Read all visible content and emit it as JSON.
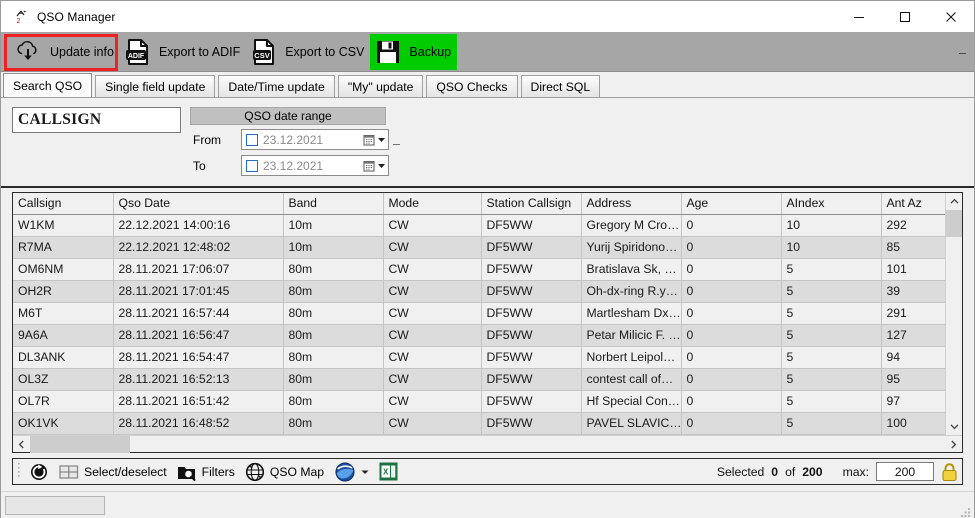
{
  "window": {
    "title": "QSO Manager",
    "icon": "antenna-icon",
    "controls": {
      "minimize": "minimize-icon",
      "maximize": "maximize-icon",
      "close": "close-icon"
    }
  },
  "toolbar": {
    "items": [
      {
        "label": "Update info",
        "icon": "cloud-download-icon",
        "focused": true,
        "highlight": "none"
      },
      {
        "label": "Export to ADIF",
        "icon": "adif-file-icon",
        "focused": false,
        "highlight": "none"
      },
      {
        "label": "Export to CSV",
        "icon": "csv-file-icon",
        "focused": false,
        "highlight": "none"
      },
      {
        "label": "Backup",
        "icon": "floppy-disk-icon",
        "focused": false,
        "highlight": "#00cc00"
      }
    ],
    "focus_ring_color": "#ee2222"
  },
  "tabs": [
    {
      "label": "Search QSO",
      "active": true
    },
    {
      "label": "Single field update",
      "active": false
    },
    {
      "label": "Date/Time update",
      "active": false
    },
    {
      "label": "\"My\" update",
      "active": false
    },
    {
      "label": "QSO Checks",
      "active": false
    },
    {
      "label": "Direct SQL",
      "active": false
    }
  ],
  "search_panel": {
    "callsign": {
      "value": "CALLSIGN",
      "placeholder": "CALLSIGN"
    },
    "date_range_title": "QSO date range",
    "from": {
      "label": "From",
      "value": "23.12.2021",
      "checked": false,
      "dropdown_icon": "calendar-icon"
    },
    "to": {
      "label": "To",
      "value": "23.12.2021",
      "checked": false,
      "dropdown_icon": "calendar-icon"
    }
  },
  "grid": {
    "columns": [
      "Callsign",
      "Qso Date",
      "Band",
      "Mode",
      "Station Callsign",
      "Address",
      "Age",
      "AIndex",
      "Ant Az"
    ],
    "rows": [
      [
        "W1KM",
        "22.12.2021 14:00:16",
        "10m",
        "CW",
        "DF5WW",
        "Gregory M Cro…",
        "0",
        "10",
        "292"
      ],
      [
        "R7MA",
        "22.12.2021 12:48:02",
        "10m",
        "CW",
        "DF5WW",
        "Yurij Spiridono…",
        "0",
        "10",
        "85"
      ],
      [
        "OM6NM",
        "28.11.2021 17:06:07",
        "80m",
        "CW",
        "DF5WW",
        "Bratislava Sk, …",
        "0",
        "5",
        "101"
      ],
      [
        "OH2R",
        "28.11.2021 17:01:45",
        "80m",
        "CW",
        "DF5WW",
        "Oh-dx-ring R.y…",
        "0",
        "5",
        "39"
      ],
      [
        "M6T",
        "28.11.2021 16:57:44",
        "80m",
        "CW",
        "DF5WW",
        "Martlesham Dx…",
        "0",
        "5",
        "291"
      ],
      [
        "9A6A",
        "28.11.2021 16:56:47",
        "80m",
        "CW",
        "DF5WW",
        "Petar Milicic F. …",
        "0",
        "5",
        "127"
      ],
      [
        "DL3ANK",
        "28.11.2021 16:54:47",
        "80m",
        "CW",
        "DF5WW",
        "Norbert Leipol…",
        "0",
        "5",
        "94"
      ],
      [
        "OL3Z",
        "28.11.2021 16:52:13",
        "80m",
        "CW",
        "DF5WW",
        "contest call of…",
        "0",
        "5",
        "95"
      ],
      [
        "OL7R",
        "28.11.2021 16:51:42",
        "80m",
        "CW",
        "DF5WW",
        "Hf Special Con…",
        "0",
        "5",
        "97"
      ],
      [
        "OK1VK",
        "28.11.2021 16:48:52",
        "80m",
        "CW",
        "DF5WW",
        "PAVEL SLAVIC…",
        "0",
        "5",
        "100"
      ]
    ],
    "vscroll": {
      "up_icon": "chevron-up-icon",
      "down_icon": "chevron-down-icon"
    },
    "hscroll": {
      "left_icon": "chevron-left-icon",
      "right_icon": "chevron-right-icon"
    }
  },
  "bottom_bar": {
    "items": [
      {
        "label": "",
        "icon": "refresh-icon"
      },
      {
        "label": "Select/deselect",
        "icon": "grid-select-icon"
      },
      {
        "label": "Filters",
        "icon": "filter-folder-icon"
      },
      {
        "label": "QSO Map",
        "icon": "globe-icon"
      },
      {
        "label": "",
        "icon": "google-earth-icon"
      },
      {
        "label": "",
        "icon": "excel-icon"
      }
    ],
    "selected_label": "Selected",
    "selected_count": "0",
    "of_label": "of",
    "total_count": "200",
    "max_label": "max:",
    "max_value": "200",
    "lock_icon": "lock-icon"
  },
  "status_bar": {
    "cell_text": "",
    "resize_grip": "resize-grip-icon"
  }
}
